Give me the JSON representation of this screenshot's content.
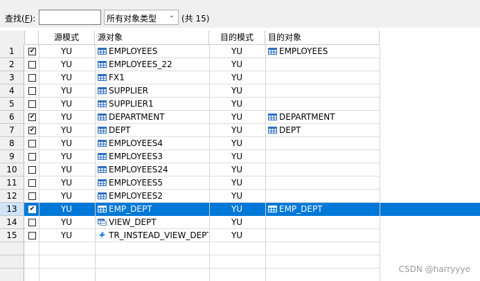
{
  "toolbar": {
    "find_label_pre": "查找(",
    "find_label_key": "F",
    "find_label_post": "):",
    "find_value": "",
    "type_select_value": "所有对象类型",
    "count_text": "(共 15)"
  },
  "columns": {
    "source_mode": "源模式",
    "source_object": "源对象",
    "target_mode": "目的模式",
    "target_object": "目的对象"
  },
  "rows": [
    {
      "num": "1",
      "checked": true,
      "src_mode": "YU",
      "src_obj": "EMPLOYEES",
      "src_icon": "table-icon",
      "dst_mode": "YU",
      "dst_obj": "EMPLOYEES",
      "dst_icon": "table-icon"
    },
    {
      "num": "2",
      "checked": false,
      "src_mode": "YU",
      "src_obj": "EMPLOYEES_22",
      "src_icon": "table-icon",
      "dst_mode": "YU",
      "dst_obj": "",
      "dst_icon": ""
    },
    {
      "num": "3",
      "checked": false,
      "src_mode": "YU",
      "src_obj": "FX1",
      "src_icon": "table-icon",
      "dst_mode": "YU",
      "dst_obj": "",
      "dst_icon": ""
    },
    {
      "num": "4",
      "checked": false,
      "src_mode": "YU",
      "src_obj": "SUPPLIER",
      "src_icon": "table-icon",
      "dst_mode": "YU",
      "dst_obj": "",
      "dst_icon": ""
    },
    {
      "num": "5",
      "checked": false,
      "src_mode": "YU",
      "src_obj": "SUPPLIER1",
      "src_icon": "table-icon",
      "dst_mode": "YU",
      "dst_obj": "",
      "dst_icon": ""
    },
    {
      "num": "6",
      "checked": true,
      "src_mode": "YU",
      "src_obj": "DEPARTMENT",
      "src_icon": "table-icon",
      "dst_mode": "YU",
      "dst_obj": "DEPARTMENT",
      "dst_icon": "table-icon"
    },
    {
      "num": "7",
      "checked": true,
      "src_mode": "YU",
      "src_obj": "DEPT",
      "src_icon": "table-icon",
      "dst_mode": "YU",
      "dst_obj": "DEPT",
      "dst_icon": "table-icon"
    },
    {
      "num": "8",
      "checked": false,
      "src_mode": "YU",
      "src_obj": "EMPLOYEES4",
      "src_icon": "table-icon",
      "dst_mode": "YU",
      "dst_obj": "",
      "dst_icon": ""
    },
    {
      "num": "9",
      "checked": false,
      "src_mode": "YU",
      "src_obj": "EMPLOYEES3",
      "src_icon": "table-icon",
      "dst_mode": "YU",
      "dst_obj": "",
      "dst_icon": ""
    },
    {
      "num": "10",
      "checked": false,
      "src_mode": "YU",
      "src_obj": "EMPLOYEES24",
      "src_icon": "table-icon",
      "dst_mode": "YU",
      "dst_obj": "",
      "dst_icon": ""
    },
    {
      "num": "11",
      "checked": false,
      "src_mode": "YU",
      "src_obj": "EMPLOYEES5",
      "src_icon": "table-icon",
      "dst_mode": "YU",
      "dst_obj": "",
      "dst_icon": ""
    },
    {
      "num": "12",
      "checked": false,
      "src_mode": "YU",
      "src_obj": "EMPLOYEES2",
      "src_icon": "table-icon",
      "dst_mode": "YU",
      "dst_obj": "",
      "dst_icon": ""
    },
    {
      "num": "13",
      "checked": true,
      "selected": true,
      "src_mode": "YU",
      "src_obj": "EMP_DEPT",
      "src_icon": "table-icon",
      "dst_mode": "YU",
      "dst_obj": "EMP_DEPT",
      "dst_icon": "table-icon"
    },
    {
      "num": "14",
      "checked": false,
      "src_mode": "YU",
      "src_obj": "VIEW_DEPT",
      "src_icon": "view-icon",
      "dst_mode": "YU",
      "dst_obj": "",
      "dst_icon": ""
    },
    {
      "num": "15",
      "checked": false,
      "src_mode": "YU",
      "src_obj": "TR_INSTEAD_VIEW_DEPT",
      "src_icon": "trigger-icon",
      "dst_mode": "YU",
      "dst_obj": "",
      "dst_icon": ""
    }
  ],
  "watermark": "CSDN @harryyye",
  "colors": {
    "selection": "#0078d7",
    "table_icon": "#2f6fbd",
    "trigger_icon": "#1e88e5"
  }
}
